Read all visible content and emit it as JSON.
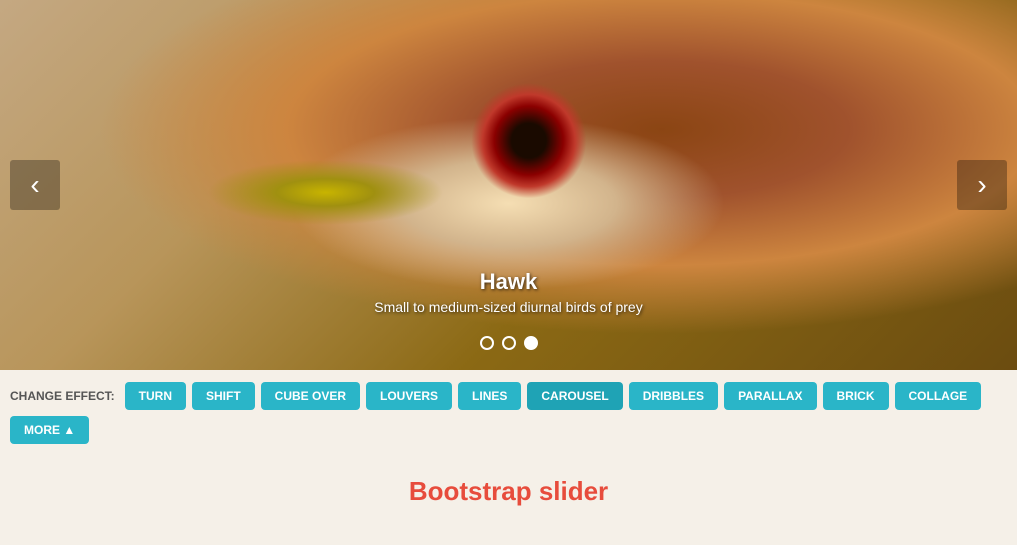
{
  "carousel": {
    "caption": {
      "title": "Hawk",
      "description": "Small to medium-sized diurnal birds of prey"
    },
    "indicators": [
      {
        "id": 0,
        "active": false
      },
      {
        "id": 1,
        "active": false
      },
      {
        "id": 2,
        "active": true
      }
    ],
    "prev_label": "‹",
    "next_label": "›"
  },
  "effects_bar": {
    "label": "CHANGE EFFECT:",
    "buttons": [
      {
        "id": "turn",
        "label": "TURN"
      },
      {
        "id": "shift",
        "label": "SHIFT"
      },
      {
        "id": "cube-over",
        "label": "CUBE OVER"
      },
      {
        "id": "louvers",
        "label": "LOUVERS"
      },
      {
        "id": "lines",
        "label": "LINES"
      },
      {
        "id": "carousel",
        "label": "CAROUSEL",
        "active": true
      },
      {
        "id": "dribbles",
        "label": "DRIBBLES"
      },
      {
        "id": "parallax",
        "label": "PARALLAX"
      },
      {
        "id": "brick",
        "label": "BRICK"
      },
      {
        "id": "collage",
        "label": "COLLAGE"
      },
      {
        "id": "more",
        "label": "MORE ▲"
      }
    ]
  },
  "page_title": "Bootstrap slider"
}
